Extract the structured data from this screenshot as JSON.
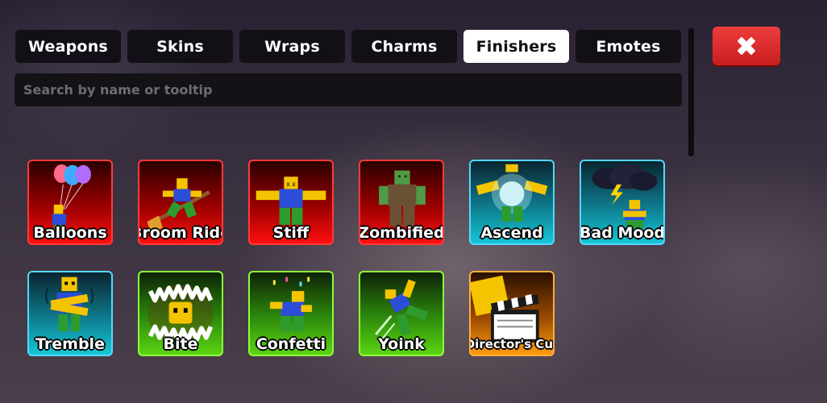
{
  "tabs": [
    {
      "label": "Weapons",
      "active": false
    },
    {
      "label": "Skins",
      "active": false
    },
    {
      "label": "Wraps",
      "active": false
    },
    {
      "label": "Charms",
      "active": false
    },
    {
      "label": "Finishers",
      "active": true
    },
    {
      "label": "Emotes",
      "active": false
    }
  ],
  "search": {
    "placeholder": "Search by name or tooltip",
    "value": ""
  },
  "close_icon": "close-x-icon",
  "rarity_colors": {
    "red": "#ff3a3a",
    "blue": "#53d8ff",
    "green": "#8cff3a",
    "orange": "#ffae3a"
  },
  "finishers": [
    {
      "name": "Balloons",
      "rarity": "red",
      "icon": "balloons-icon"
    },
    {
      "name": "Broom Ride",
      "rarity": "red",
      "icon": "broom-icon"
    },
    {
      "name": "Stiff",
      "rarity": "red",
      "icon": "stiff-noob-icon"
    },
    {
      "name": "Zombified",
      "rarity": "red",
      "icon": "zombie-icon"
    },
    {
      "name": "Ascend",
      "rarity": "blue",
      "icon": "ascend-icon"
    },
    {
      "name": "Bad Mood",
      "rarity": "blue",
      "icon": "storm-cloud-icon"
    },
    {
      "name": "Tremble",
      "rarity": "blue",
      "icon": "tremble-icon"
    },
    {
      "name": "Bite",
      "rarity": "green",
      "icon": "bite-jaws-icon"
    },
    {
      "name": "Confetti",
      "rarity": "green",
      "icon": "confetti-icon"
    },
    {
      "name": "Yoink",
      "rarity": "green",
      "icon": "yoink-icon"
    },
    {
      "name": "Director's Cut",
      "rarity": "orange",
      "icon": "clapperboard-icon"
    }
  ]
}
